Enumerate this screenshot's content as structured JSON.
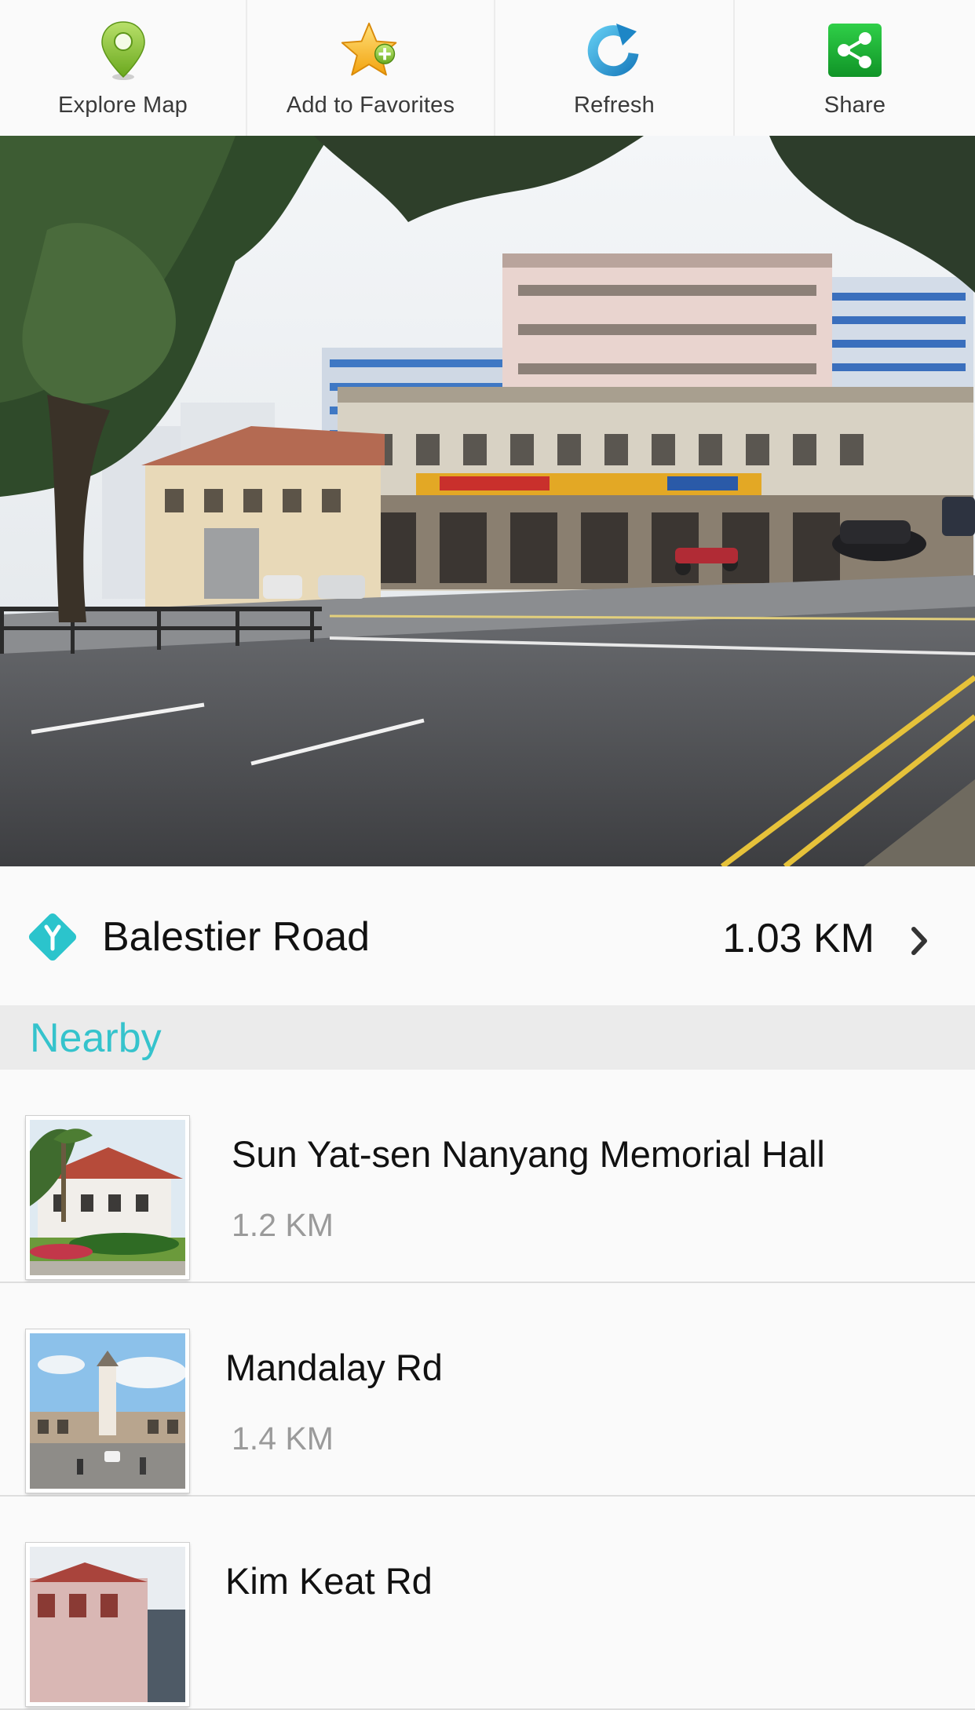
{
  "toolbar": {
    "items": [
      {
        "label": "Explore Map",
        "icon": "map-pin-icon"
      },
      {
        "label": "Add to Favorites",
        "icon": "star-add-icon"
      },
      {
        "label": "Refresh",
        "icon": "refresh-icon"
      },
      {
        "label": "Share",
        "icon": "share-icon"
      }
    ]
  },
  "hero": {
    "alt": "Street view photo of Balestier Road"
  },
  "location": {
    "name": "Balestier Road",
    "distance": "1.03 KM",
    "icon": "directions-icon",
    "accent_color": "#2bc4cc"
  },
  "nearby": {
    "title": "Nearby",
    "title_color": "#35c3cc",
    "items": [
      {
        "title": "Sun Yat-sen Nanyang Memorial Hall",
        "distance": "1.2 KM"
      },
      {
        "title": "Mandalay Rd",
        "distance": "1.4 KM"
      },
      {
        "title": "Kim Keat Rd",
        "distance": ""
      }
    ]
  }
}
